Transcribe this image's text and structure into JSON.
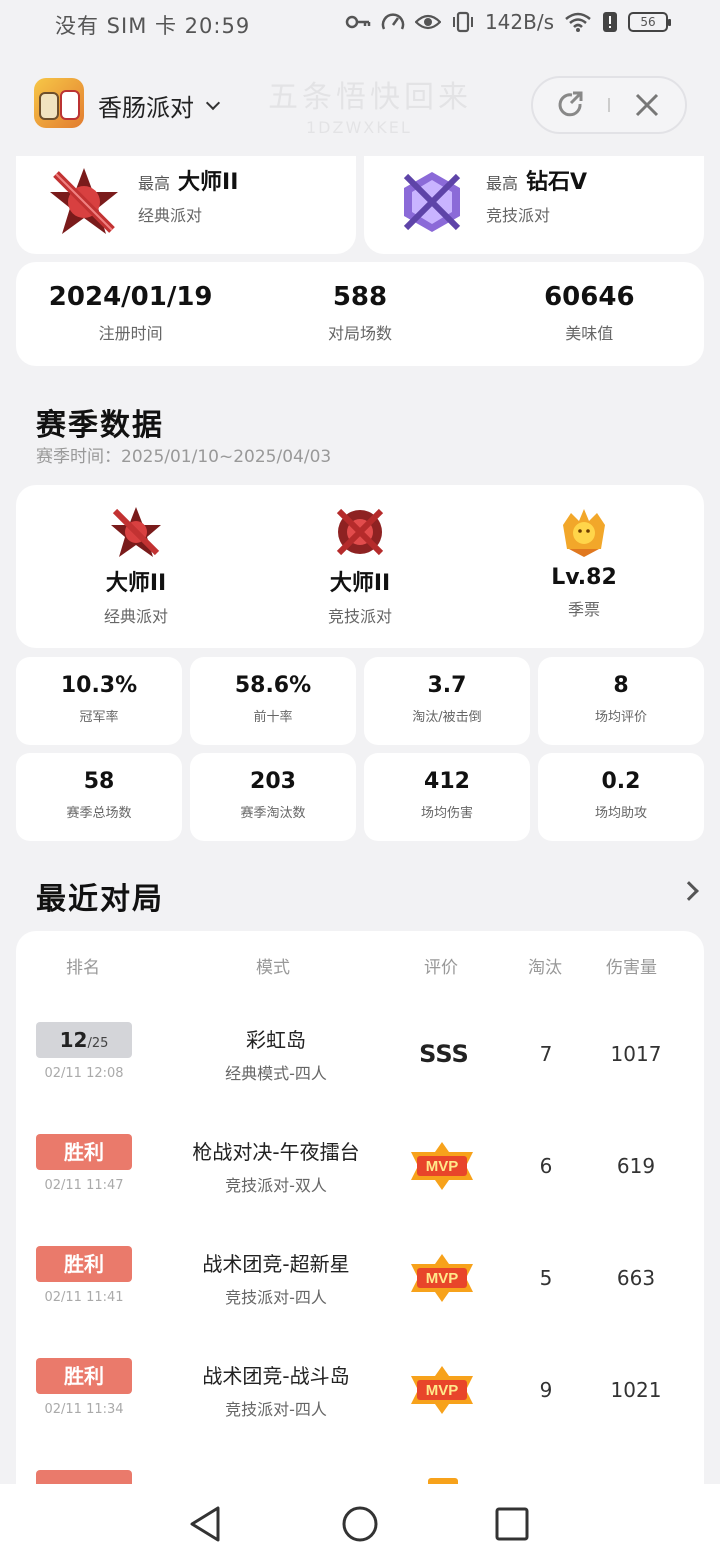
{
  "status_bar": {
    "left_text": "没有 SIM 卡 20:59",
    "speed": "142B/s",
    "battery": "56"
  },
  "app_header": {
    "app_name": "香肠派对",
    "ghost_title": "五条悟快回来",
    "ghost_subtitle": "1DZWXKEL"
  },
  "top_ranks": [
    {
      "prefix": "最高",
      "rank": "大师II",
      "mode": "经典派对"
    },
    {
      "prefix": "最高",
      "rank": "钻石V",
      "mode": "竞技派对"
    }
  ],
  "profile_stats": [
    {
      "value": "2024/01/19",
      "label": "注册时间"
    },
    {
      "value": "588",
      "label": "对局场数"
    },
    {
      "value": "60646",
      "label": "美味值"
    }
  ],
  "season": {
    "title": "赛季数据",
    "time_label": "赛季时间：",
    "time_range": "2025/01/10~2025/04/03",
    "ranks": [
      {
        "value": "大师II",
        "label": "经典派对"
      },
      {
        "value": "大师II",
        "label": "竞技派对"
      },
      {
        "value": "Lv.82",
        "label": "季票"
      }
    ],
    "stats": [
      {
        "value": "10.3%",
        "label": "冠军率"
      },
      {
        "value": "58.6%",
        "label": "前十率"
      },
      {
        "value": "3.7",
        "label": "淘汰/被击倒"
      },
      {
        "value": "8",
        "label": "场均评价"
      },
      {
        "value": "58",
        "label": "赛季总场数"
      },
      {
        "value": "203",
        "label": "赛季淘汰数"
      },
      {
        "value": "412",
        "label": "场均伤害"
      },
      {
        "value": "0.2",
        "label": "场均助攻"
      }
    ]
  },
  "recent": {
    "title": "最近对局",
    "headers": {
      "place": "排名",
      "mode": "模式",
      "rating": "评价",
      "kills": "淘汰",
      "damage": "伤害量"
    },
    "rows": [
      {
        "place": "12",
        "place_total": "/25",
        "time": "02/11 12:08",
        "map": "彩虹岛",
        "mode": "经典模式-四人",
        "rating": "SSS",
        "kills": "7",
        "damage": "1017"
      },
      {
        "place": "胜利",
        "time": "02/11 11:47",
        "map": "枪战对决-午夜擂台",
        "mode": "竞技派对-双人",
        "rating": "MVP",
        "kills": "6",
        "damage": "619"
      },
      {
        "place": "胜利",
        "time": "02/11 11:41",
        "map": "战术团竞-超新星",
        "mode": "竞技派对-四人",
        "rating": "MVP",
        "kills": "5",
        "damage": "663"
      },
      {
        "place": "胜利",
        "time": "02/11 11:34",
        "map": "战术团竞-战斗岛",
        "mode": "竞技派对-四人",
        "rating": "MVP",
        "kills": "9",
        "damage": "1021"
      }
    ]
  },
  "colors": {
    "win_badge": "#ea7a6b",
    "rank_badge": "#d4d5d9",
    "page_bg": "#f2f2f4"
  },
  "icons": {
    "status": [
      "key-icon",
      "gauge-icon",
      "eye-icon",
      "vibrate-icon",
      "wifi-icon",
      "battery-icon"
    ],
    "capsule": [
      "share-icon",
      "close-icon"
    ],
    "nav": [
      "back-icon",
      "home-icon",
      "recents-icon"
    ]
  }
}
